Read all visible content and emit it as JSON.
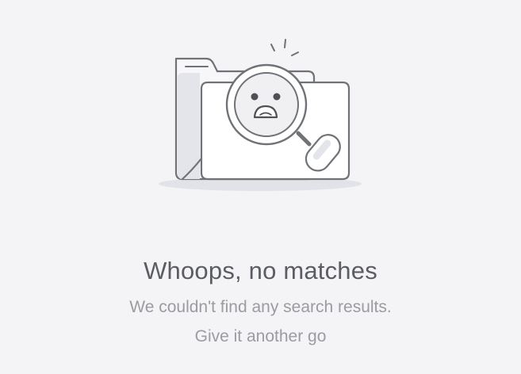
{
  "empty_state": {
    "illustration_icon": "folder-magnifier-sad-face-icon",
    "title": "Whoops, no matches",
    "message_line1": "We couldn't find any search results.",
    "message_line2": "Give it another go"
  },
  "colors": {
    "background": "#f4f4f6",
    "title_text": "#5b5d63",
    "message_text": "#9a9ca1",
    "illustration_stroke": "#6f7277",
    "illustration_shadow": "#dcdde2"
  }
}
